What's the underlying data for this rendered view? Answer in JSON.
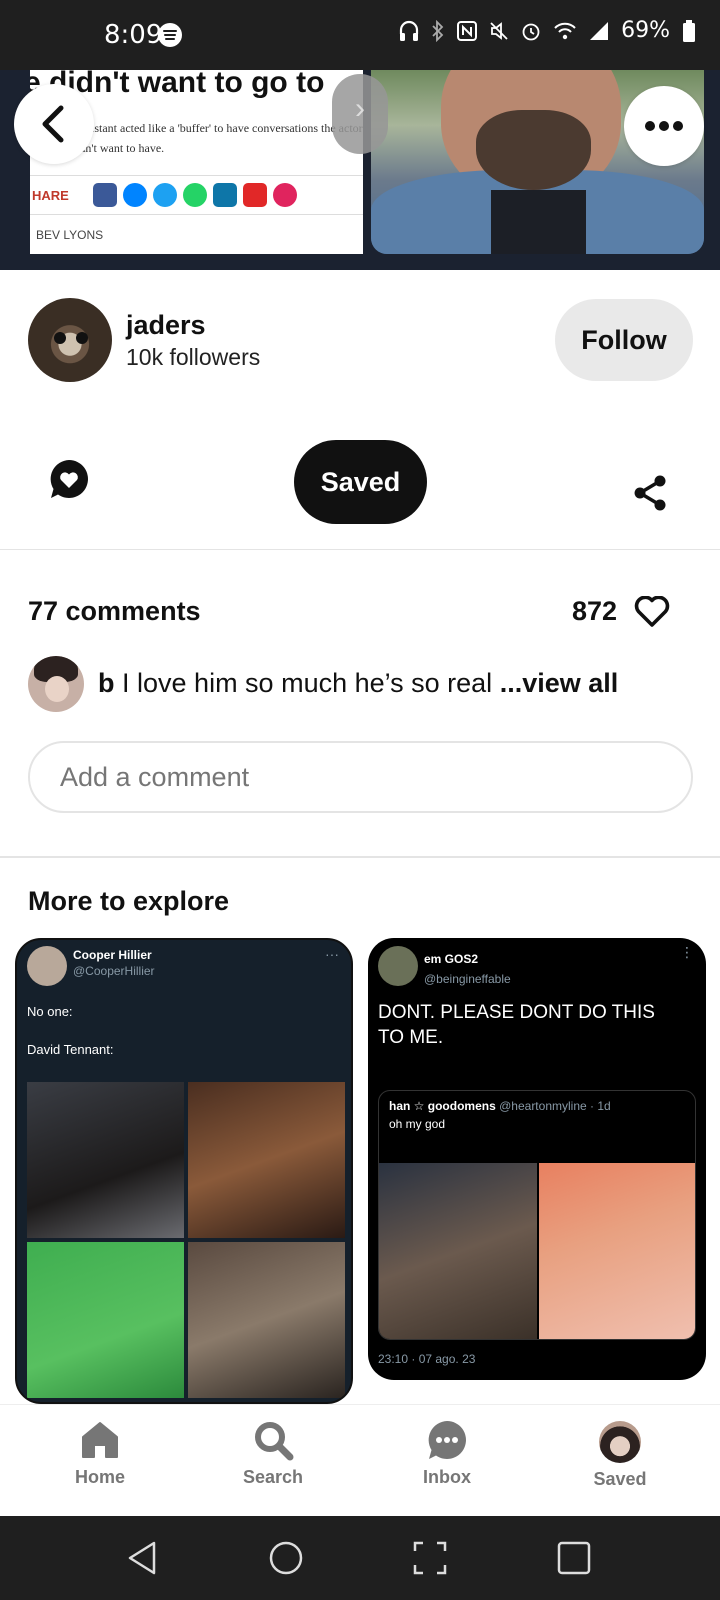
{
  "status_bar": {
    "time": "8:09",
    "battery": "69%"
  },
  "hero": {
    "headline": "e didn't want to go to",
    "subtext": "l assistant acted like a 'buffer' to have conversations the actor didn't want to have.",
    "share_label": "HARE",
    "byline": "BEV LYONS"
  },
  "profile": {
    "username": "jaders",
    "followers": "10k followers",
    "follow_label": "Follow"
  },
  "actions": {
    "saved_label": "Saved"
  },
  "comments": {
    "count_label": "77 comments",
    "likes": "872",
    "preview_author": "b",
    "preview_text": "I love him so much he’s so real",
    "view_all": "...view all",
    "input_placeholder": "Add a comment"
  },
  "explore": {
    "title": "More to explore",
    "card_a": {
      "name": "Cooper Hillier",
      "handle": "@CooperHillier",
      "line1": "No one:",
      "line2": "David Tennant:"
    },
    "card_b": {
      "name": "em GOS2",
      "handle": "@beingineffable",
      "text": "DONT. PLEASE DONT DO THIS TO ME.",
      "quote_author": "han ☆ goodomens",
      "quote_meta": "@heartonmyline · 1d",
      "quote_text": "oh my god",
      "timestamp": "23:10 · 07 ago. 23"
    }
  },
  "bottom_nav": {
    "home": "Home",
    "search": "Search",
    "inbox": "Inbox",
    "saved": "Saved"
  },
  "colors": {
    "accent_dark": "#111111",
    "pill_grey": "#e9e9e9",
    "nav_label": "#767676"
  }
}
